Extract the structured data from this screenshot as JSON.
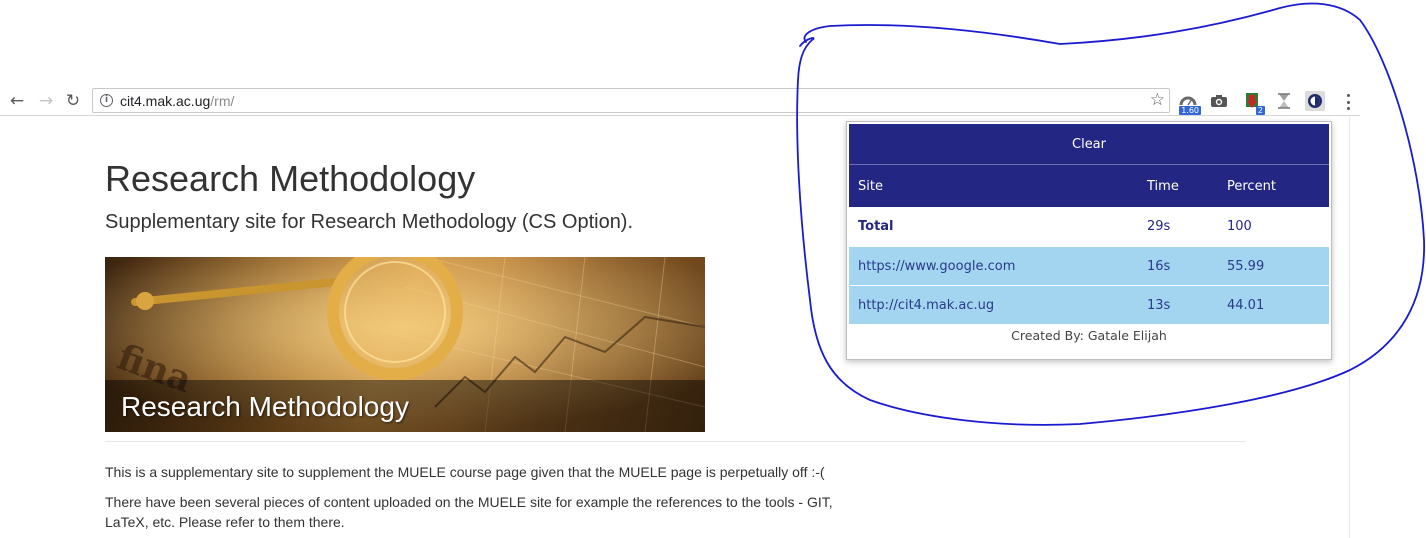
{
  "browser": {
    "url_host": "cit4.mak.ac.ug",
    "url_path": "/rm/",
    "extensions": [
      {
        "name": "speed-dial-extension",
        "badge": "1.60"
      },
      {
        "name": "camera-extension",
        "badge": ""
      },
      {
        "name": "downloader-extension",
        "badge": "2"
      },
      {
        "name": "hourglass-extension",
        "badge": ""
      },
      {
        "name": "time-tracker-extension",
        "badge": ""
      }
    ]
  },
  "page": {
    "title": "Research Methodology",
    "subtitle": "Supplementary site for Research Methodology (CS Option).",
    "banner_caption": "Research Methodology",
    "paragraphs": [
      "This is a supplementary site to supplement the MUELE course page given that the MUELE page is perpetually off :-(",
      "There have been several pieces of content uploaded on the MUELE site for example the references to the tools - GIT, LaTeX, etc. Please refer to them there."
    ]
  },
  "popup": {
    "clear_label": "Clear",
    "columns": {
      "site": "Site",
      "time": "Time",
      "percent": "Percent"
    },
    "total": {
      "site": "Total",
      "time": "29s",
      "percent": "100"
    },
    "rows": [
      {
        "site": "https://www.google.com",
        "time": "16s",
        "percent": "55.99"
      },
      {
        "site": "http://cit4.mak.ac.ug",
        "time": "13s",
        "percent": "44.01"
      }
    ],
    "credit": "Created By: Gatale Elijah"
  },
  "colors": {
    "popup_header": "#232783",
    "popup_row": "#a3d5f0",
    "annotation_stroke": "#1a1ad0"
  }
}
